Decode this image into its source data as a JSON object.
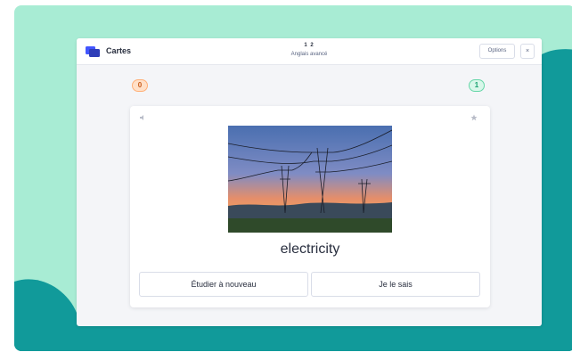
{
  "header": {
    "app_title": "Cartes",
    "progress": "1 2",
    "set_title": "Anglais avancé",
    "options_label": "Options",
    "close_label": "×"
  },
  "counters": {
    "still_learning": "0",
    "known": "1"
  },
  "card": {
    "term": "electricity",
    "image": "power-lines-sunset-photo"
  },
  "actions": {
    "study_again_label": "Étudier à nouveau",
    "know_it_label": "Je le sais"
  },
  "colors": {
    "background_mint": "#a8ecd4",
    "background_teal": "#119a9a",
    "brand_blue": "#4255ff",
    "still_learning_orange": "#ff8a3d",
    "known_green": "#18a070"
  }
}
